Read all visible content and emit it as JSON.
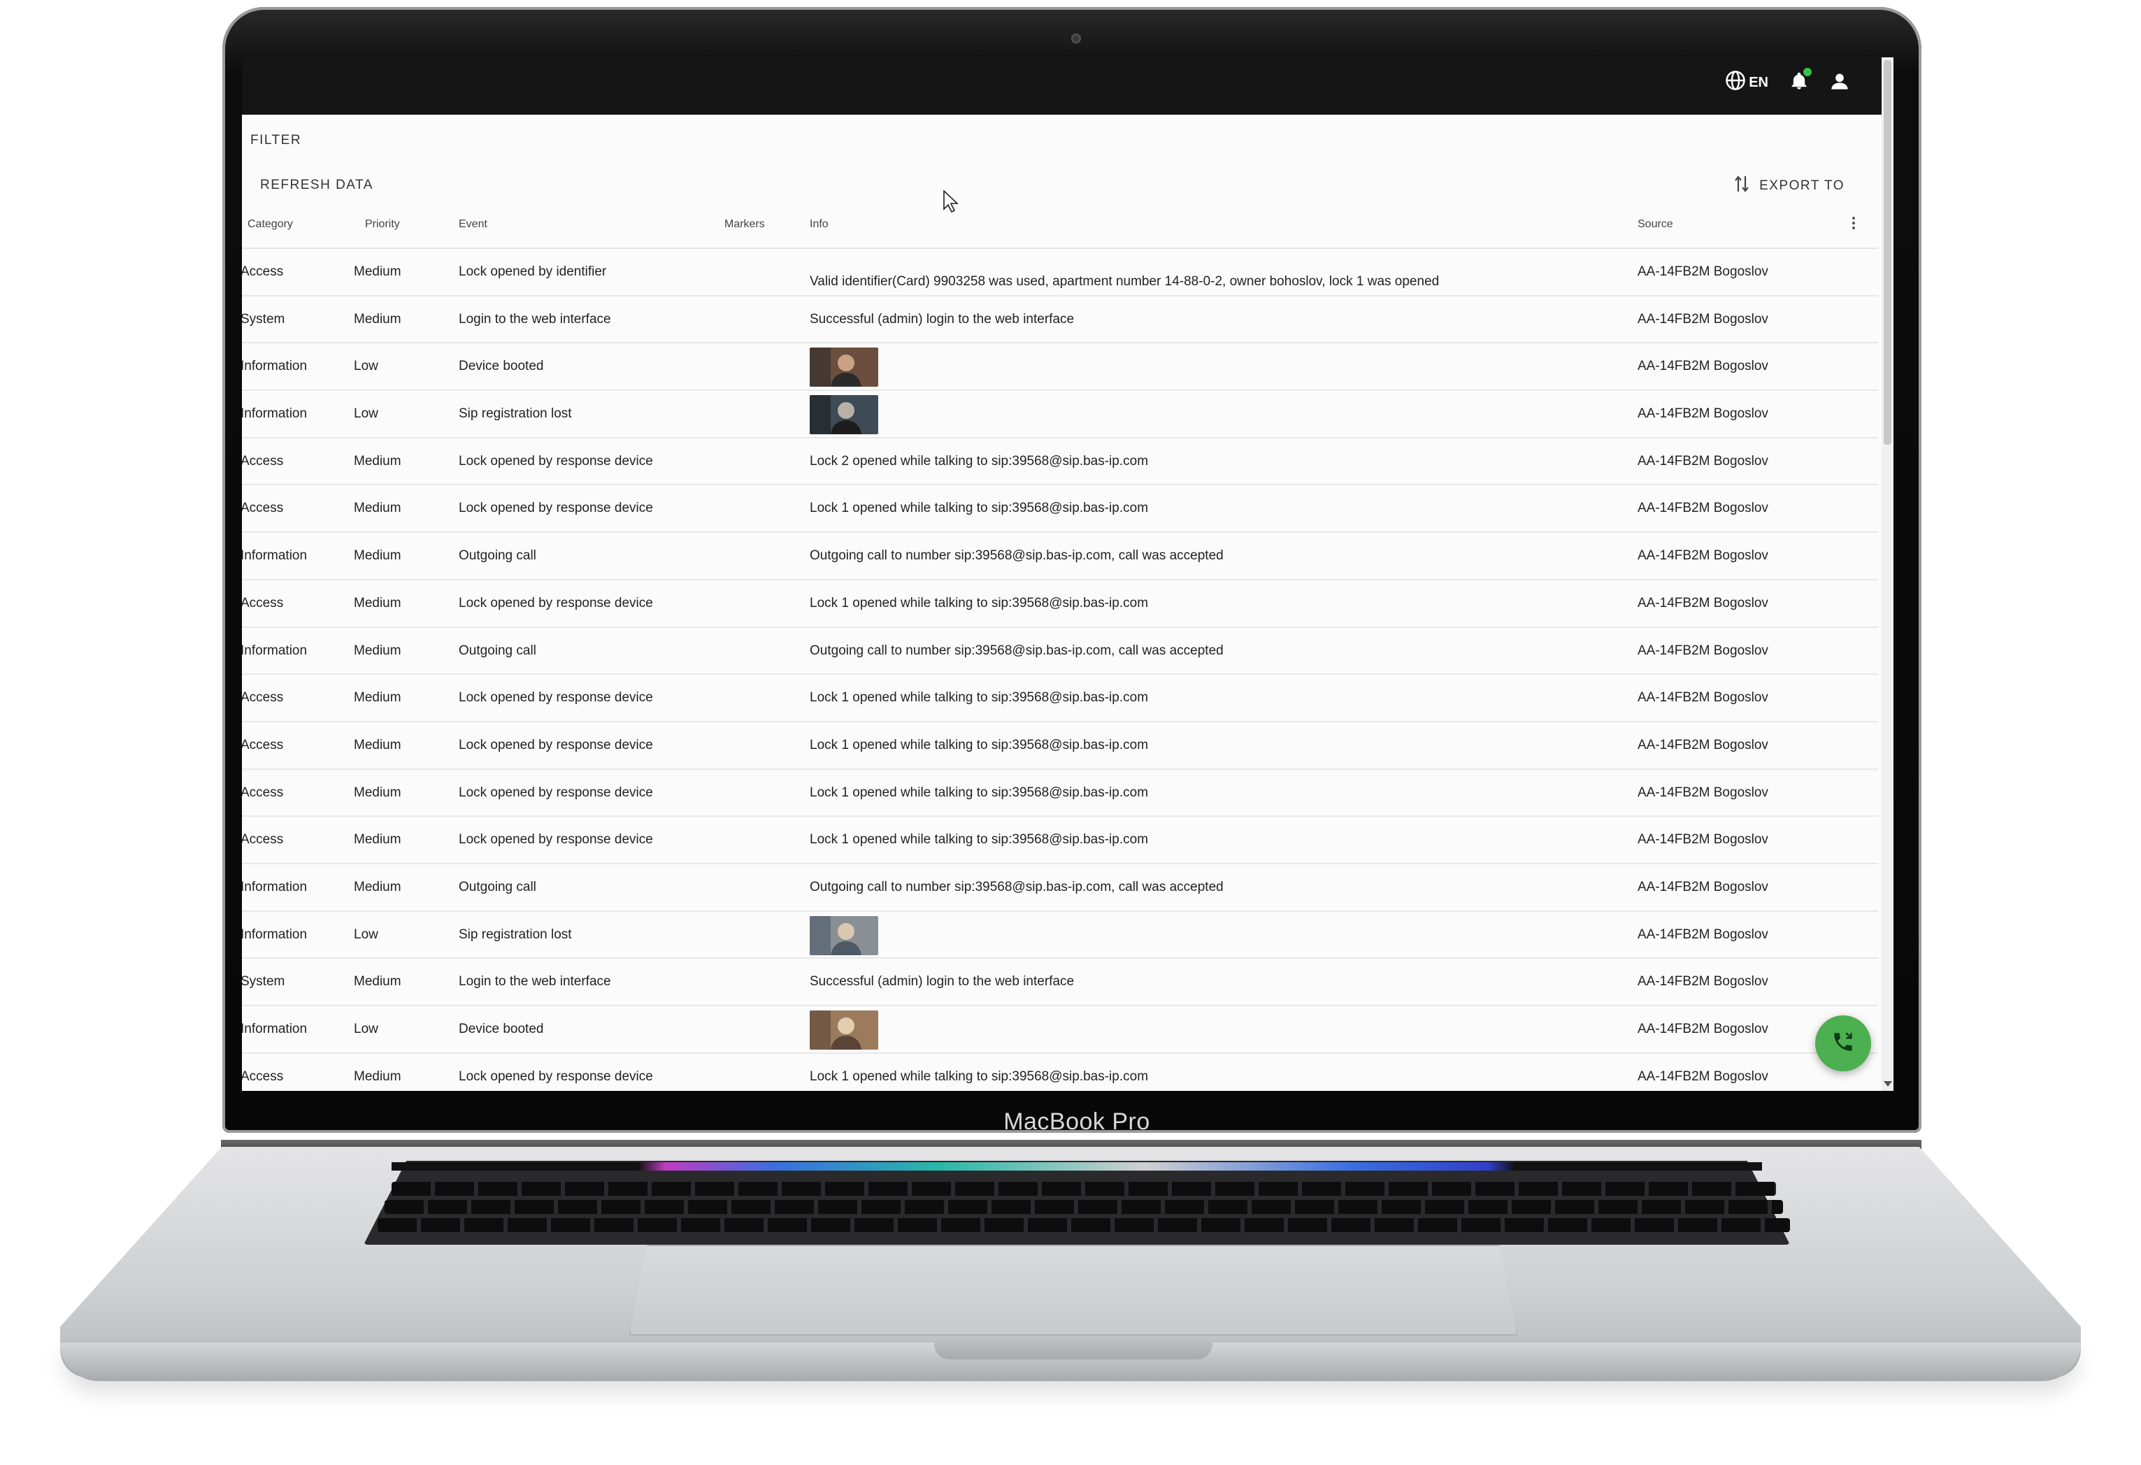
{
  "device": {
    "label": "MacBook Pro"
  },
  "header": {
    "language": "EN"
  },
  "toolbar": {
    "filter": "FILTER",
    "refresh": "REFRESH DATA",
    "export": "EXPORT TO"
  },
  "table": {
    "columns": [
      "Category",
      "Priority",
      "Event",
      "Markers",
      "Info",
      "Source"
    ],
    "rows": [
      {
        "category": "Access",
        "priority": "Medium",
        "event": "Lock opened by identifier",
        "info": "Valid identifier(Card) 9903258 was used, apartment number 14-88-0-2, owner bohoslov, lock 1 was opened",
        "source": "AA-14FB2M Bogoslov"
      },
      {
        "category": "System",
        "priority": "Medium",
        "event": "Login to the web interface",
        "info": "Successful (admin) login to the web interface",
        "source": "AA-14FB2M Bogoslov"
      },
      {
        "category": "Information",
        "priority": "Low",
        "event": "Device booted",
        "info": "",
        "source": "AA-14FB2M Bogoslov"
      },
      {
        "category": "Information",
        "priority": "Low",
        "event": "Sip registration lost",
        "info": "",
        "source": "AA-14FB2M Bogoslov"
      },
      {
        "category": "Access",
        "priority": "Medium",
        "event": "Lock opened by response device",
        "info": "Lock 2 opened while talking to sip:39568@sip.bas-ip.com",
        "source": "AA-14FB2M Bogoslov"
      },
      {
        "category": "Access",
        "priority": "Medium",
        "event": "Lock opened by response device",
        "info": "Lock 1 opened while talking to sip:39568@sip.bas-ip.com",
        "source": "AA-14FB2M Bogoslov"
      },
      {
        "category": "Information",
        "priority": "Medium",
        "event": "Outgoing call",
        "info": "Outgoing call to number sip:39568@sip.bas-ip.com, call was accepted",
        "source": "AA-14FB2M Bogoslov"
      },
      {
        "category": "Access",
        "priority": "Medium",
        "event": "Lock opened by response device",
        "info": "Lock 1 opened while talking to sip:39568@sip.bas-ip.com",
        "source": "AA-14FB2M Bogoslov"
      },
      {
        "category": "Information",
        "priority": "Medium",
        "event": "Outgoing call",
        "info": "Outgoing call to number sip:39568@sip.bas-ip.com, call was accepted",
        "source": "AA-14FB2M Bogoslov"
      },
      {
        "category": "Access",
        "priority": "Medium",
        "event": "Lock opened by response device",
        "info": "Lock 1 opened while talking to sip:39568@sip.bas-ip.com",
        "source": "AA-14FB2M Bogoslov"
      },
      {
        "category": "Access",
        "priority": "Medium",
        "event": "Lock opened by response device",
        "info": "Lock 1 opened while talking to sip:39568@sip.bas-ip.com",
        "source": "AA-14FB2M Bogoslov"
      },
      {
        "category": "Access",
        "priority": "Medium",
        "event": "Lock opened by response device",
        "info": "Lock 1 opened while talking to sip:39568@sip.bas-ip.com",
        "source": "AA-14FB2M Bogoslov"
      },
      {
        "category": "Access",
        "priority": "Medium",
        "event": "Lock opened by response device",
        "info": "Lock 1 opened while talking to sip:39568@sip.bas-ip.com",
        "source": "AA-14FB2M Bogoslov"
      },
      {
        "category": "Information",
        "priority": "Medium",
        "event": "Outgoing call",
        "info": "Outgoing call to number sip:39568@sip.bas-ip.com, call was accepted",
        "source": "AA-14FB2M Bogoslov"
      },
      {
        "category": "Information",
        "priority": "Low",
        "event": "Sip registration lost",
        "info": "",
        "source": "AA-14FB2M Bogoslov"
      },
      {
        "category": "System",
        "priority": "Medium",
        "event": "Login to the web interface",
        "info": "Successful (admin) login to the web interface",
        "source": "AA-14FB2M Bogoslov"
      },
      {
        "category": "Information",
        "priority": "Low",
        "event": "Device booted",
        "info": "",
        "source": "AA-14FB2M Bogoslov"
      },
      {
        "category": "Access",
        "priority": "Medium",
        "event": "Lock opened by response device",
        "info": "Lock 1 opened while talking to sip:39568@sip.bas-ip.com",
        "source": "AA-14FB2M Bogoslov"
      }
    ]
  },
  "icons": {
    "globe": "globe-icon",
    "bell": "bell-icon",
    "user": "user-icon",
    "export": "sort-arrows-icon",
    "menu": "more-vert-icon",
    "call": "phone-call-icon"
  },
  "colors": {
    "appbar": "#151515",
    "accent": "#4caf50",
    "notification_dot": "#39c34a"
  }
}
